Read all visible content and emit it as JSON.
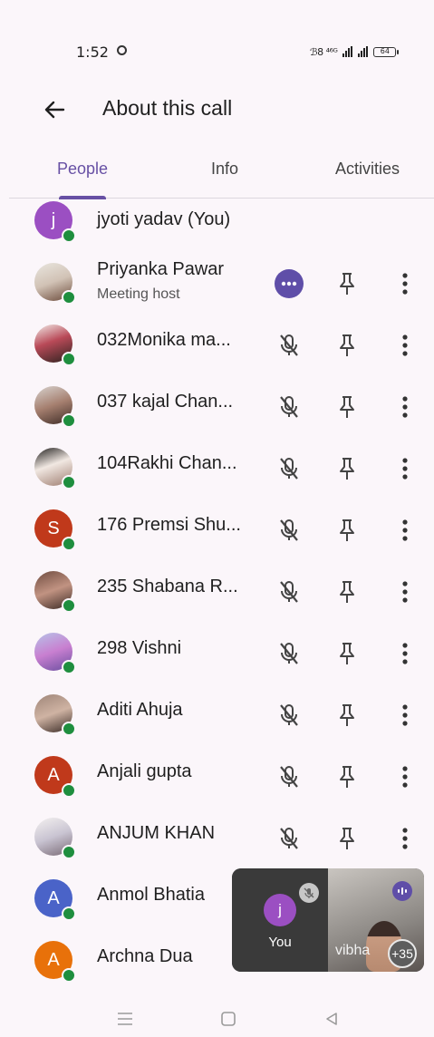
{
  "status": {
    "time": "1:52",
    "signal_text": "ℬ8 ⁴⁶ᴳ",
    "battery": "64"
  },
  "appbar": {
    "title": "About this call"
  },
  "tabs": [
    {
      "label": "People",
      "active": true
    },
    {
      "label": "Info",
      "active": false
    },
    {
      "label": "Activities",
      "active": false
    }
  ],
  "participants": [
    {
      "name": "jyoti yadav (You)",
      "avatar": "j",
      "color": "#9b4fc2"
    },
    {
      "name": "Priyanka Pawar",
      "subtitle": "Meeting host",
      "avatar": "photo"
    },
    {
      "name": "032Monika ma...",
      "avatar": "photo"
    },
    {
      "name": "037 kajal Chan...",
      "avatar": "photo"
    },
    {
      "name": "104Rakhi Chan...",
      "avatar": "photo"
    },
    {
      "name": "176 Premsi Shu...",
      "avatar": "S",
      "color": "#c0391b"
    },
    {
      "name": "235 Shabana R...",
      "avatar": "photo"
    },
    {
      "name": "298 Vishni",
      "avatar": "photo"
    },
    {
      "name": "Aditi Ahuja",
      "avatar": "photo"
    },
    {
      "name": "Anjali gupta",
      "avatar": "A",
      "color": "#c0391b"
    },
    {
      "name": "ANJUM KHAN",
      "avatar": "photo"
    },
    {
      "name": "Anmol Bhatia",
      "avatar": "A",
      "color": "#4a63c8"
    },
    {
      "name": "Archna Dua",
      "avatar": "A",
      "color": "#e8710a"
    }
  ],
  "pip": {
    "you_avatar": "j",
    "you_label": "You",
    "other_name": "vibha",
    "more_count": "+35"
  },
  "colors": {
    "accent": "#6750a4",
    "online": "#1e8e3e",
    "background": "#fbf6fa"
  }
}
